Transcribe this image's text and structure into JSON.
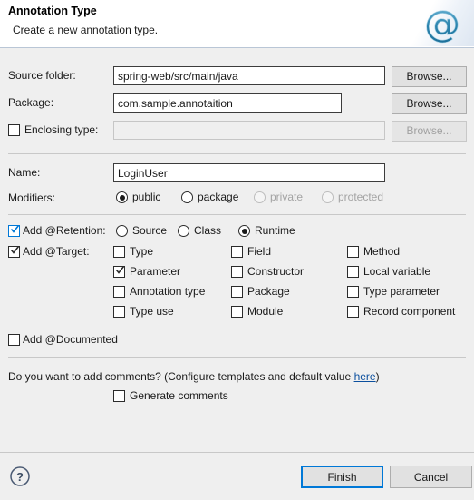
{
  "header": {
    "title": "Annotation Type",
    "description": "Create a new annotation type.",
    "icon": "at-sign-icon"
  },
  "form": {
    "source_folder": {
      "label": "Source folder:",
      "value": "spring-web/src/main/java",
      "browse_label": "Browse..."
    },
    "package": {
      "label": "Package:",
      "value": "com.sample.annotaition",
      "browse_label": "Browse..."
    },
    "enclosing_type": {
      "label": "Enclosing type:",
      "checked": false,
      "value": "",
      "browse_label": "Browse...",
      "disabled": true
    },
    "name": {
      "label": "Name:",
      "value": "LoginUser"
    },
    "modifiers": {
      "label": "Modifiers:",
      "options": [
        {
          "label": "public",
          "selected": true,
          "disabled": false
        },
        {
          "label": "package",
          "selected": false,
          "disabled": false
        },
        {
          "label": "private",
          "selected": false,
          "disabled": true
        },
        {
          "label": "protected",
          "selected": false,
          "disabled": true
        }
      ]
    }
  },
  "retention": {
    "label": "Add @Retention:",
    "checked": true,
    "focused": true,
    "options": [
      {
        "label": "Source",
        "selected": false
      },
      {
        "label": "Class",
        "selected": false
      },
      {
        "label": "Runtime",
        "selected": true
      }
    ]
  },
  "target": {
    "label": "Add @Target:",
    "checked": true,
    "columns": [
      [
        {
          "label": "Type",
          "checked": false
        },
        {
          "label": "Parameter",
          "checked": true
        },
        {
          "label": "Annotation type",
          "checked": false
        },
        {
          "label": "Type use",
          "checked": false
        }
      ],
      [
        {
          "label": "Field",
          "checked": false
        },
        {
          "label": "Constructor",
          "checked": false
        },
        {
          "label": "Package",
          "checked": false
        },
        {
          "label": "Module",
          "checked": false
        }
      ],
      [
        {
          "label": "Method",
          "checked": false
        },
        {
          "label": "Local variable",
          "checked": false
        },
        {
          "label": "Type parameter",
          "checked": false
        },
        {
          "label": "Record component",
          "checked": false
        }
      ]
    ]
  },
  "documented": {
    "label": "Add @Documented",
    "checked": false
  },
  "comments": {
    "question_prefix": "Do you want to add comments? (Configure templates and default value ",
    "link_text": "here",
    "question_suffix": ")",
    "generate_label": "Generate comments",
    "generate_checked": false
  },
  "footer": {
    "help_icon": "help-circle-icon",
    "finish_label": "Finish",
    "cancel_label": "Cancel"
  },
  "colors": {
    "accent": "#0078d7",
    "link": "#0b4f9e",
    "background": "#efefef",
    "field_bg": "#ffffff"
  }
}
